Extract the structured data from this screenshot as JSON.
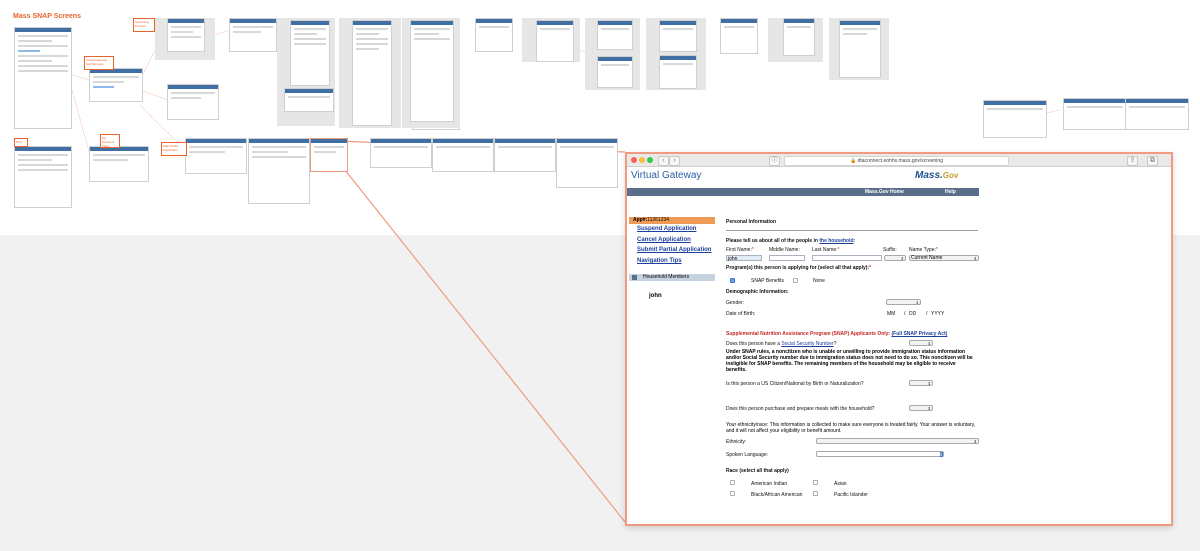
{
  "board": {
    "title": "Mass SNAP Screens"
  },
  "notes": [
    {
      "text": "Screening Process"
    },
    {
      "text": "Virtual Gateway Self Services"
    },
    {
      "text": "Print"
    },
    {
      "text": "My Accounts Page"
    },
    {
      "text": "Start Online Application"
    }
  ],
  "browser": {
    "url": "dtaconnect.eohhs.mass.gov/screening",
    "back": "‹",
    "forward": "›",
    "info": "ⓘ"
  },
  "site": {
    "title": "Virtual Gateway",
    "logo": "Mass.",
    "logo_suffix": "Gov",
    "nav": [
      "Mass.Gov Home",
      "Help"
    ]
  },
  "sidebar": {
    "app_label": "App#:",
    "app_number": "11261234",
    "links": [
      "Suspend Application",
      "Cancel Application",
      "Submit Partial Application",
      "Navigation Tips"
    ],
    "household_label": "Household Members",
    "member": "john"
  },
  "form": {
    "section_title": "Personal Information",
    "prompt": "Please tell us about all of the people in ",
    "prompt_link": "the household",
    "prompt_end": ":",
    "first_name_label": "First Name:",
    "first_name_value": "john",
    "middle_name_label": "Middle Name:",
    "last_name_label": "Last Name:",
    "suffix_label": "Suffix:",
    "name_type_label": "Name Type:",
    "name_type_value": "Current Name",
    "required_mark": "*",
    "programs_label": "Program(s) this person is applying for (select all that apply):",
    "program_snap": "SNAP Benefits",
    "program_none": "None",
    "demographic_label": "Demographic Information:",
    "gender_label": "Gender:",
    "dob_label": "Date of Birth:",
    "dob_mm": "MM",
    "dob_dd": "DD",
    "dob_yyyy": "YYYY",
    "dob_sep": "/",
    "snap_title": "Supplemental Nutrition Assistance Program (SNAP) Applicants Only:",
    "snap_privacy": "(Full SNAP Privacy Act)",
    "ssn_q_start": "Does this person have a ",
    "ssn_link": "Social Security Number",
    "ssn_q_end": "?",
    "noncitizen_text": "Under SNAP rules, a noncitizen who is unable or unwilling to provide immigration status information and/or Social Security number due to immigration status does not need to do so. This noncitizen will be ineligible for SNAP benefits. The remaining members of the household may be eligible to receive benefits.",
    "citizen_q": "Is this person a US Citizen/National by Birth or Naturalization?",
    "meals_q": "Does this person purchase and prepare meals with the household?",
    "ethnicity_note": "Your ethnicity/race: This information is collected to make sure everyone is treated fairly. Your answer is voluntary, and it will not affect your eligibility or benefit amount.",
    "ethnicity_label": "Ethnicity:",
    "language_label": "Spoken Language:",
    "race_label": "Race (select all that apply)",
    "race_options": [
      "American Indian",
      "Asian",
      "Black/African American",
      "Pacific Islander"
    ]
  },
  "colors": {
    "accent": "#e8632b",
    "highlight_border": "#ef9b80",
    "nav_bar": "#5a6e8a",
    "link": "#1a3f9c",
    "required": "#c62828"
  }
}
